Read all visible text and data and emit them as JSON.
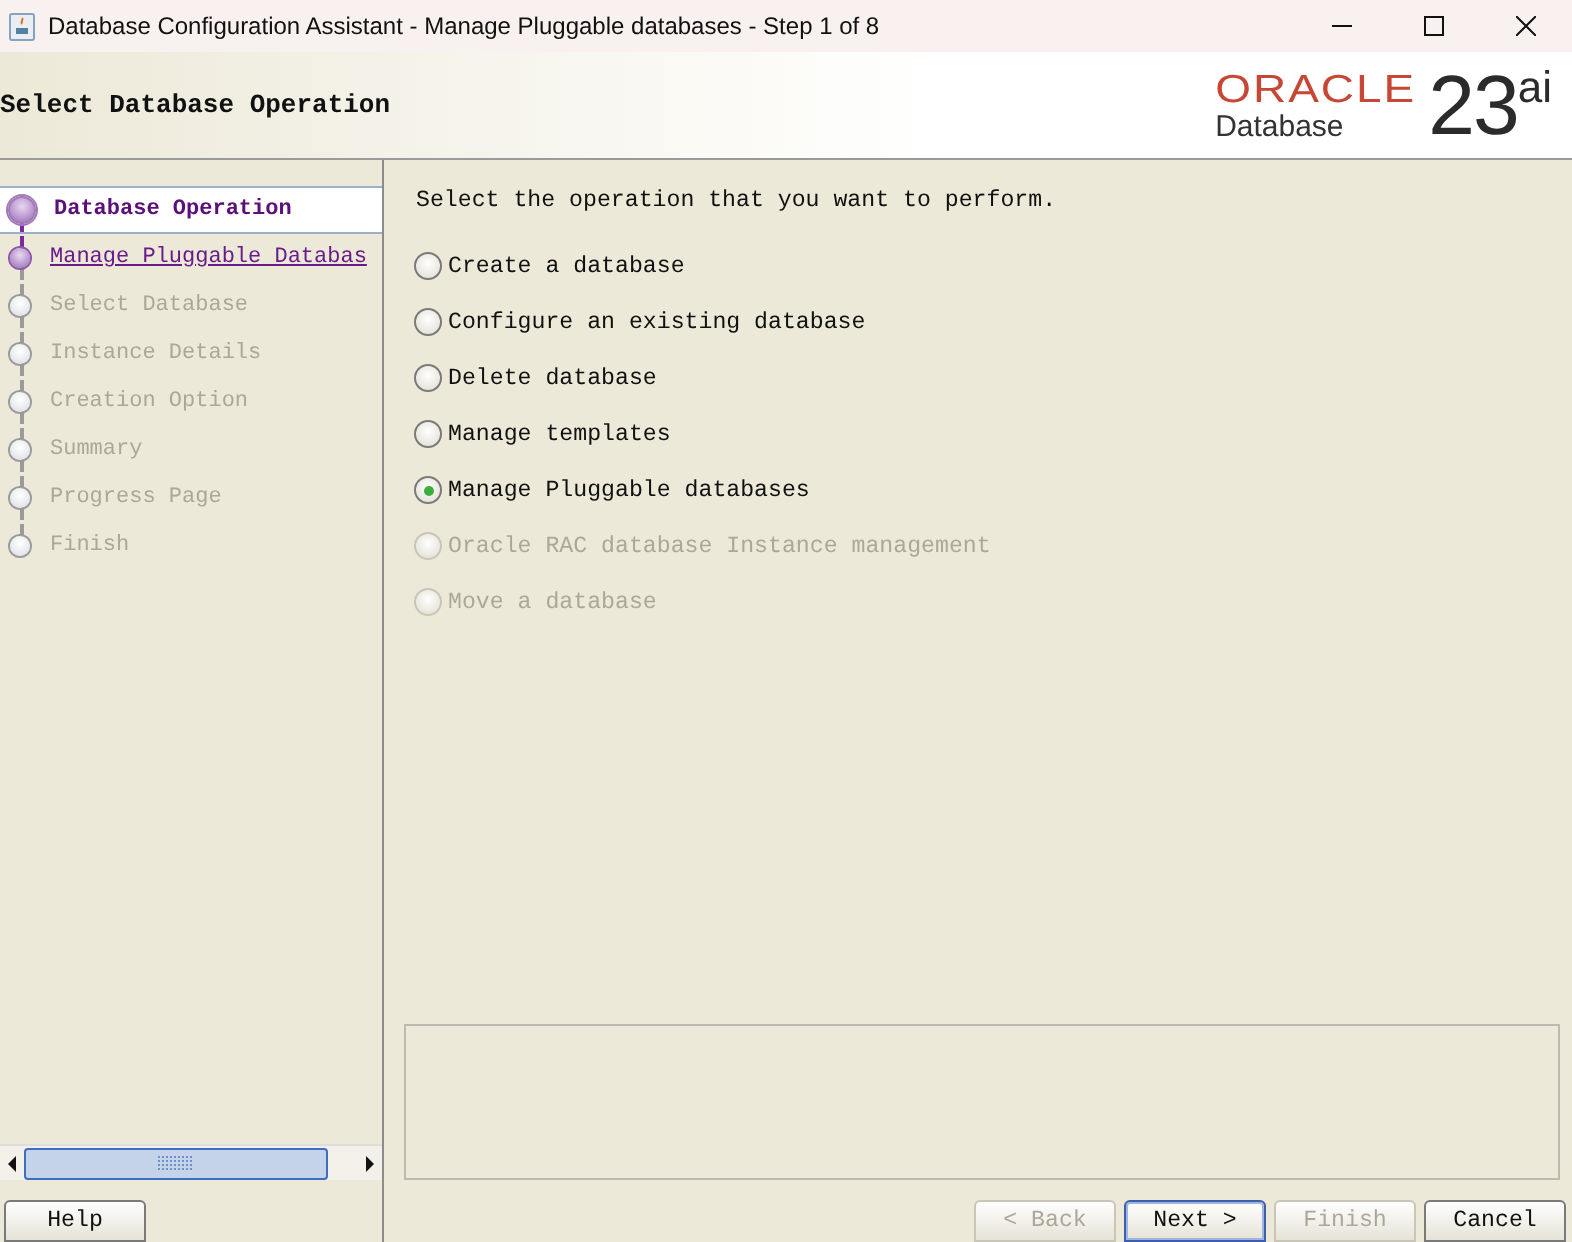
{
  "window": {
    "title": "Database Configuration Assistant - Manage Pluggable databases - Step 1 of 8"
  },
  "header": {
    "title": "Select Database Operation",
    "logo": {
      "brand": "ORACLE",
      "product": "Database",
      "version": "23",
      "suffix": "ai"
    }
  },
  "steps": [
    {
      "label": "Database Operation",
      "current": true,
      "visited": true
    },
    {
      "label": "Manage Pluggable Databas",
      "current": false,
      "visited": true
    },
    {
      "label": "Select Database",
      "current": false,
      "visited": false
    },
    {
      "label": "Instance Details",
      "current": false,
      "visited": false
    },
    {
      "label": "Creation Option",
      "current": false,
      "visited": false
    },
    {
      "label": "Summary",
      "current": false,
      "visited": false
    },
    {
      "label": "Progress Page",
      "current": false,
      "visited": false
    },
    {
      "label": "Finish",
      "current": false,
      "visited": false
    }
  ],
  "prompt": "Select the operation that you want to perform.",
  "options": [
    {
      "label": "Create a database",
      "selected": false,
      "disabled": false
    },
    {
      "label": "Configure an existing database",
      "selected": false,
      "disabled": false
    },
    {
      "label": "Delete database",
      "selected": false,
      "disabled": false
    },
    {
      "label": "Manage templates",
      "selected": false,
      "disabled": false
    },
    {
      "label": "Manage Pluggable databases",
      "selected": true,
      "disabled": false
    },
    {
      "label": "Oracle RAC database Instance management",
      "selected": false,
      "disabled": true
    },
    {
      "label": "Move a database",
      "selected": false,
      "disabled": true
    }
  ],
  "help_button": {
    "label": "Help"
  },
  "buttons": [
    {
      "label": "< Back",
      "disabled": true,
      "default": false
    },
    {
      "label": "Next >",
      "disabled": false,
      "default": true
    },
    {
      "label": "Finish",
      "disabled": true,
      "default": false
    },
    {
      "label": "Cancel",
      "disabled": false,
      "default": false
    }
  ]
}
